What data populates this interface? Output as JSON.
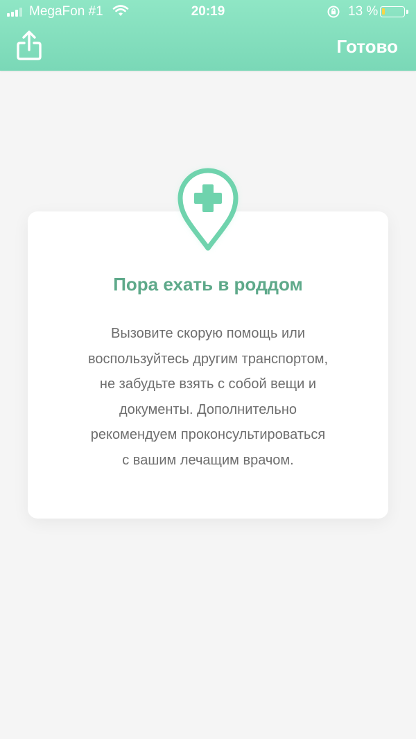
{
  "status_bar": {
    "carrier": "MegaFon #1",
    "time": "20:19",
    "battery_percent": "13 %",
    "battery_level": 0.13,
    "icons": [
      "signal-icon",
      "wifi-icon",
      "orientation-lock-icon",
      "battery-icon"
    ]
  },
  "nav": {
    "share_icon": "share-icon",
    "done_label": "Готово"
  },
  "card": {
    "icon": "medical-location-pin-icon",
    "title": "Пора ехать в роддом",
    "text": "Вызовите скорую помощь или\nвоспользуйтесь другим транспортом,\nне забудьте взять с собой вещи и\nдокументы. Дополнительно\nрекомендуем проконсультироваться\nс вашим лечащим врачом."
  },
  "colors": {
    "header": "#84dfbe",
    "accent": "#5ea98a",
    "pin": "#6fd3ad",
    "background": "#f5f5f5"
  }
}
